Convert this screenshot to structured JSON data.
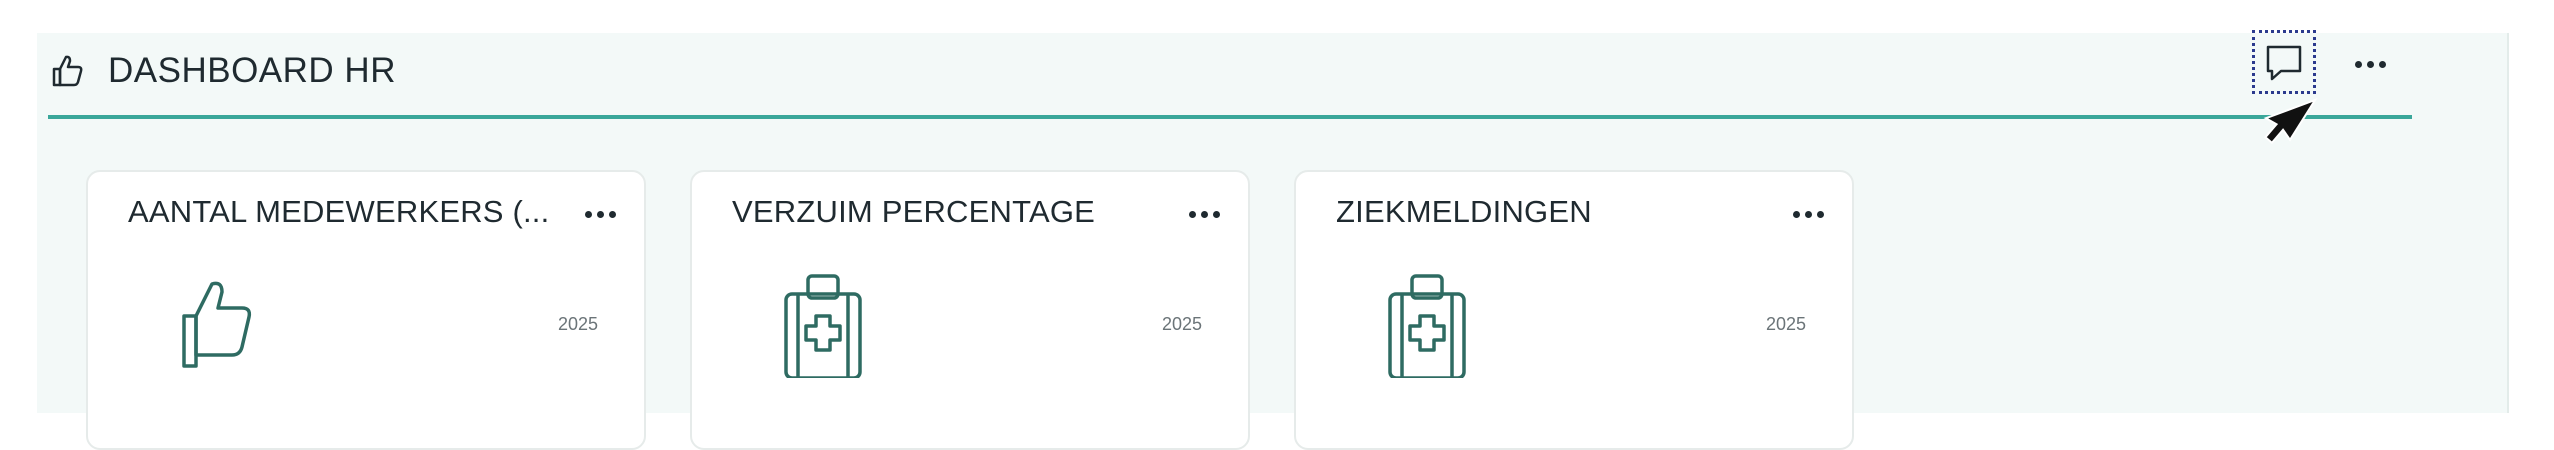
{
  "header": {
    "icon": "thumbs-up-icon",
    "title": "DASHBOARD HR",
    "comment_icon": "comment-icon",
    "more_icon": "more-horizontal-icon"
  },
  "cards": [
    {
      "title": "AANTAL MEDEWERKERS (...",
      "year": "2025",
      "icon": "thumbs-up-icon"
    },
    {
      "title": "VERZUIM PERCENTAGE",
      "year": "2025",
      "icon": "medical-kit-icon"
    },
    {
      "title": "ZIEKMELDINGEN",
      "year": "2025",
      "icon": "medical-kit-icon"
    }
  ],
  "colors": {
    "accent": "#3aa79a",
    "panel_bg": "#f3f9f8",
    "icon": "#2e6b62",
    "focus_outline": "#2b3a8e"
  }
}
